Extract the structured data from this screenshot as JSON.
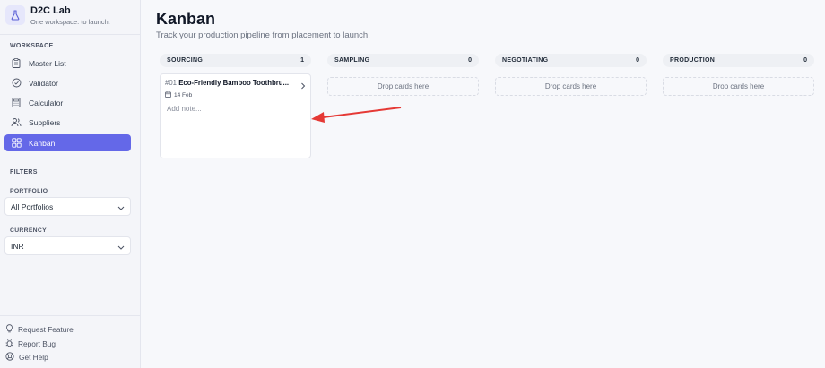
{
  "brand": {
    "title": "D2C Lab",
    "subtitle": "One workspace. to launch."
  },
  "sidebar": {
    "workspace_label": "WORKSPACE",
    "items": [
      {
        "label": "Master List",
        "icon": "clipboard-icon"
      },
      {
        "label": "Validator",
        "icon": "check-circle-icon"
      },
      {
        "label": "Calculator",
        "icon": "calculator-icon"
      },
      {
        "label": "Suppliers",
        "icon": "users-icon"
      },
      {
        "label": "Kanban",
        "icon": "kanban-icon",
        "active": true
      }
    ],
    "filters_label": "FILTERS",
    "portfolio": {
      "label": "PORTFOLIO",
      "value": "All Portfolios"
    },
    "currency": {
      "label": "CURRENCY",
      "value": "INR"
    },
    "footer": [
      {
        "label": "Request Feature",
        "icon": "lightbulb-icon"
      },
      {
        "label": "Report Bug",
        "icon": "bug-icon"
      },
      {
        "label": "Get Help",
        "icon": "help-icon"
      }
    ]
  },
  "main": {
    "title": "Kanban",
    "subtitle": "Track your production pipeline from placement to launch.",
    "columns": [
      {
        "name": "SOURCING",
        "count": "1"
      },
      {
        "name": "SAMPLING",
        "count": "0",
        "drop_text": "Drop cards here"
      },
      {
        "name": "NEGOTIATING",
        "count": "0",
        "drop_text": "Drop cards here"
      },
      {
        "name": "PRODUCTION",
        "count": "0",
        "drop_text": "Drop cards here"
      }
    ],
    "card": {
      "id": "#01",
      "title": "Eco-Friendly Bamboo Toothbru...",
      "date": "14 Feb",
      "note_placeholder": "Add note..."
    }
  },
  "colors": {
    "accent": "#6468e8",
    "annotation_arrow": "#e53935"
  }
}
